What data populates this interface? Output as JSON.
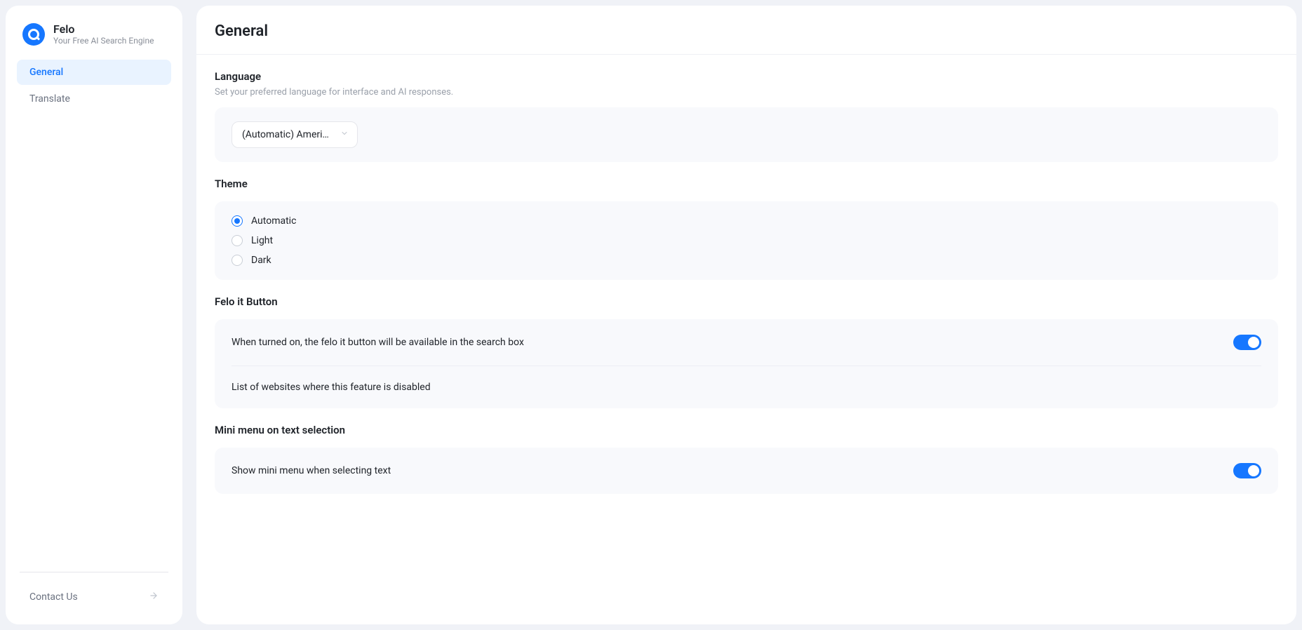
{
  "brand": {
    "name": "Felo",
    "tagline": "Your Free AI Search Engine"
  },
  "sidebar": {
    "items": [
      {
        "label": "General",
        "active": true
      },
      {
        "label": "Translate",
        "active": false
      }
    ],
    "contact": "Contact Us"
  },
  "page": {
    "title": "General",
    "language": {
      "heading": "Language",
      "description": "Set your preferred language for interface and AI responses.",
      "selected": "(Automatic) America..."
    },
    "theme": {
      "heading": "Theme",
      "options": [
        {
          "label": "Automatic",
          "checked": true
        },
        {
          "label": "Light",
          "checked": false
        },
        {
          "label": "Dark",
          "checked": false
        }
      ]
    },
    "felo_button": {
      "heading": "Felo it Button",
      "row1": "When turned on, the felo it button will be available in the search box",
      "row1_on": true,
      "row2": "List of websites where this feature is disabled"
    },
    "mini_menu": {
      "heading": "Mini menu on text selection",
      "row": "Show mini menu when selecting text",
      "on": true
    }
  }
}
